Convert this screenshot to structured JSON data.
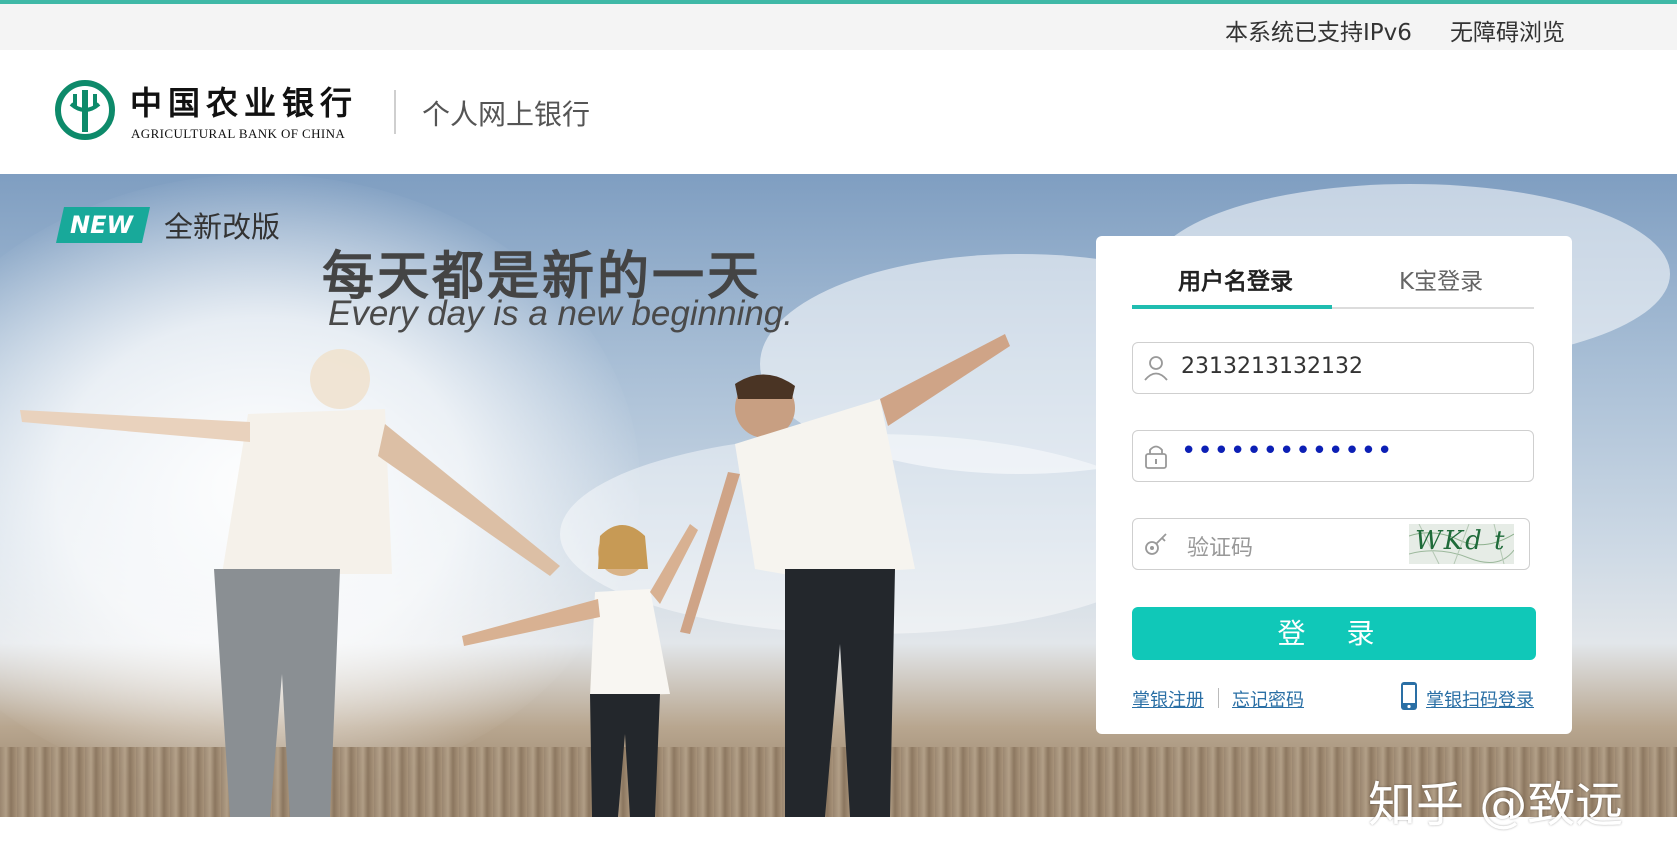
{
  "topbar": {
    "ipv6": "本系统已支持IPv6",
    "accessibility": "无障碍浏览"
  },
  "header": {
    "logo_cn": "中国农业银行",
    "logo_en": "AGRICULTURAL BANK OF CHINA",
    "product": "个人网上银行"
  },
  "banner": {
    "badge": "NEW",
    "revamp": "全新改版",
    "slogan_cn": "每天都是新的一天",
    "slogan_en": "Every day is a new beginning."
  },
  "login": {
    "tabs": [
      {
        "label": "用户名登录",
        "active": true
      },
      {
        "label": "K宝登录",
        "active": false
      }
    ],
    "username_value": "2313213132132",
    "password_value": "•••••••••••••",
    "captcha_placeholder": "验证码",
    "captcha_image_text": "WKd t",
    "submit_label": "登 录",
    "register_link": "掌银注册",
    "forgot_link": "忘记密码",
    "scan_link": "掌银扫码登录"
  },
  "watermark": "知乎 @致远",
  "colors": {
    "accent": "#10c8b8",
    "top_line": "#3fb8a6",
    "link": "#2a6fa5",
    "brand_green": "#0d8a6a"
  },
  "icons": [
    "abc-logo-icon",
    "user-icon",
    "lock-icon",
    "key-icon",
    "phone-icon"
  ]
}
